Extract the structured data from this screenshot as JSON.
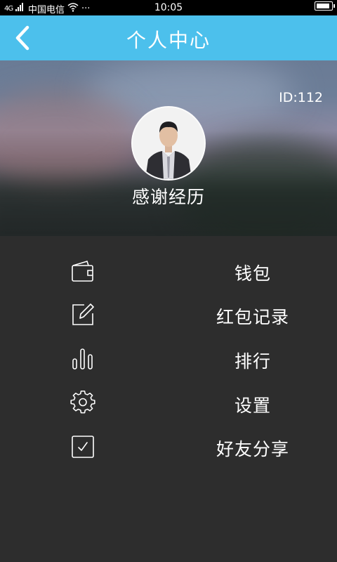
{
  "status_bar": {
    "carrier": "中国电信",
    "signal_text": "ᵡᴸᴵᴵ",
    "dots": "···",
    "time": "10:05"
  },
  "title_bar": {
    "title": "个人中心",
    "back_icon": "chevron-left-icon"
  },
  "profile": {
    "id_text": "ID:112",
    "username": "感谢经历",
    "avatar_icon": "avatar-photo"
  },
  "menu": {
    "items": [
      {
        "label": "钱包",
        "icon": "wallet-icon"
      },
      {
        "label": "红包记录",
        "icon": "edit-icon"
      },
      {
        "label": "排行",
        "icon": "bar-chart-icon"
      },
      {
        "label": "设置",
        "icon": "gear-icon"
      },
      {
        "label": "好友分享",
        "icon": "checkbox-icon"
      }
    ]
  },
  "colors": {
    "title_bar_bg": "#4cc0ec",
    "menu_bg": "#2d2d2d",
    "text": "#ffffff"
  }
}
